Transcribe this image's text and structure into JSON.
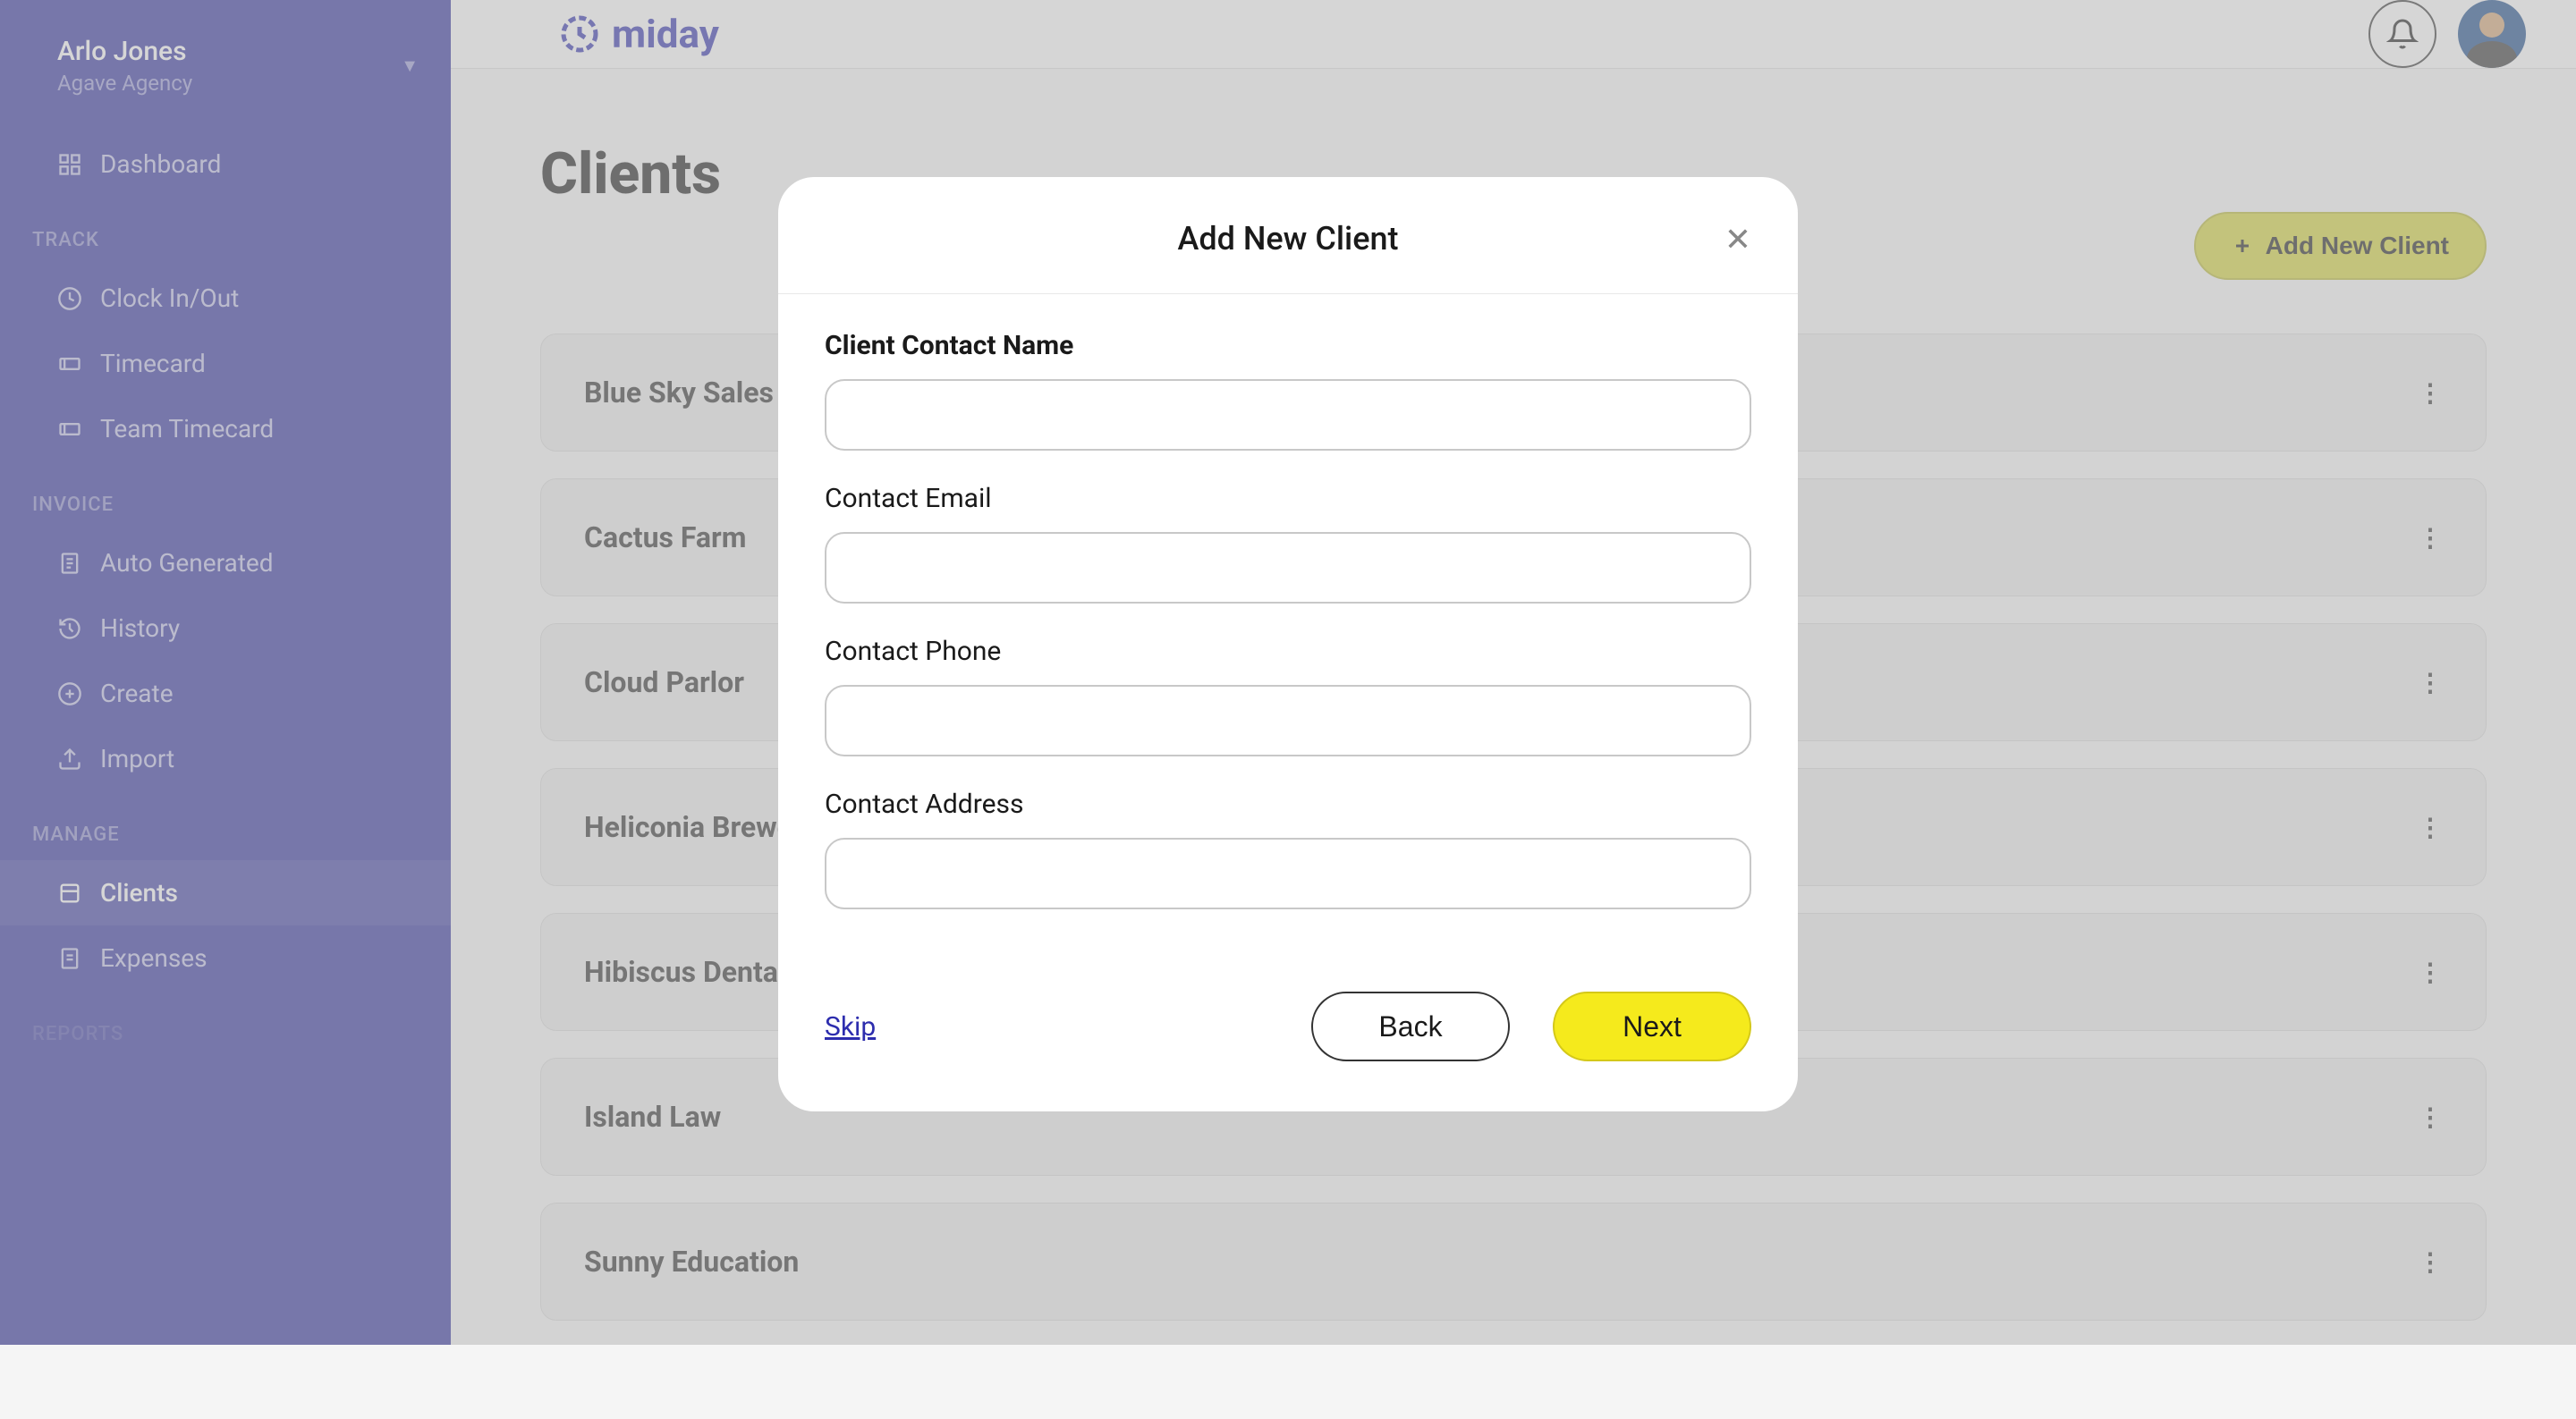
{
  "user": {
    "name": "Arlo Jones",
    "agency": "Agave Agency"
  },
  "brand": "miday",
  "sidebar": {
    "dashboard": "Dashboard",
    "sections": {
      "track": {
        "label": "TRACK",
        "items": [
          "Clock In/Out",
          "Timecard",
          "Team Timecard"
        ]
      },
      "invoice": {
        "label": "INVOICE",
        "items": [
          "Auto Generated",
          "History",
          "Create",
          "Import"
        ]
      },
      "manage": {
        "label": "MANAGE",
        "items": [
          "Clients",
          "Expenses"
        ]
      },
      "reports": {
        "label": "REPORTS"
      }
    }
  },
  "page": {
    "title": "Clients",
    "add_button": "Add New Client"
  },
  "clients": [
    "Blue Sky Sales",
    "Cactus Farm",
    "Cloud Parlor",
    "Heliconia Brewery",
    "Hibiscus Dental",
    "Island Law",
    "Sunny Education"
  ],
  "modal": {
    "title": "Add New Client",
    "fields": {
      "contact_name": "Client Contact Name",
      "contact_email": "Contact Email",
      "contact_phone": "Contact Phone",
      "contact_address": "Contact Address"
    },
    "skip": "Skip",
    "back": "Back",
    "next": "Next"
  }
}
